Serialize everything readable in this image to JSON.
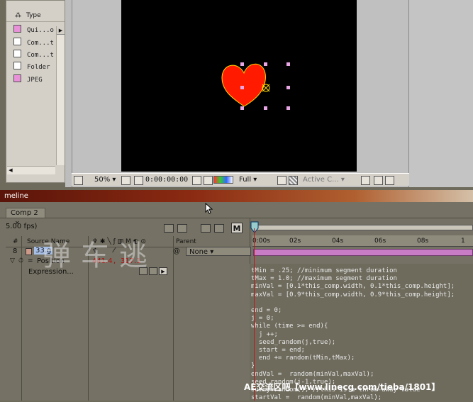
{
  "project": {
    "column_header": "Type",
    "items": [
      {
        "label": "Qui...o",
        "color": "#e890d8"
      },
      {
        "label": "Com...t",
        "color": "#ffffff"
      },
      {
        "label": "Com...t",
        "color": "#ffffff"
      },
      {
        "label": "Folder",
        "color": "#ffffff"
      },
      {
        "label": "JPEG",
        "color": "#e890d8"
      }
    ]
  },
  "viewer": {
    "zoom": "50%",
    "timecode": "0:00:00:00",
    "resolution": "Full",
    "camera": "Active C..."
  },
  "timeline": {
    "panel_title": "meline",
    "comp_tab": "Comp 2",
    "fps": "5.00 fps)",
    "columns": {
      "num": "#",
      "source": "Source Name",
      "parent": "Parent",
      "m": "M"
    },
    "layer": {
      "index": "8",
      "name": "33.g",
      "parent": "None"
    },
    "position": {
      "label": "Position",
      "value_x": "441.4",
      "value_y": "317.1"
    },
    "expression_label": "Expression...",
    "ruler_ticks": [
      "0:00s",
      "02s",
      "04s",
      "06s",
      "08s",
      "1"
    ],
    "expression_lines": [
      "tMin = .25; //minimum segment duration",
      "tMax = 1.0; //maximum segment duration",
      "minVal = [0.1*this_comp.width, 0.1*this_comp.height];",
      "maxVal = [0.9*this_comp.width, 0.9*this_comp.height];",
      "",
      "end = 0;",
      "j = 0;",
      "while (time >= end){",
      "  j ++;",
      "  seed_random(j,true);",
      "  start = end;",
      "  end += random(tMin,tMax);",
      "}",
      "endVal =  random(minVal,maxVal);",
      "seed_random(j-1,true);",
      "dummy=random(); //this is a throw-away value",
      "startVal =  random(minVal,maxVal);"
    ]
  },
  "watermark": {
    "chinese": "弹车逃",
    "site": "AE交流区吧【www.linecg.com/tieba/1801】"
  },
  "colors": {
    "heart": "#ff1a00",
    "playhead": "#c01818",
    "layer_bar": "#c87cc6"
  }
}
